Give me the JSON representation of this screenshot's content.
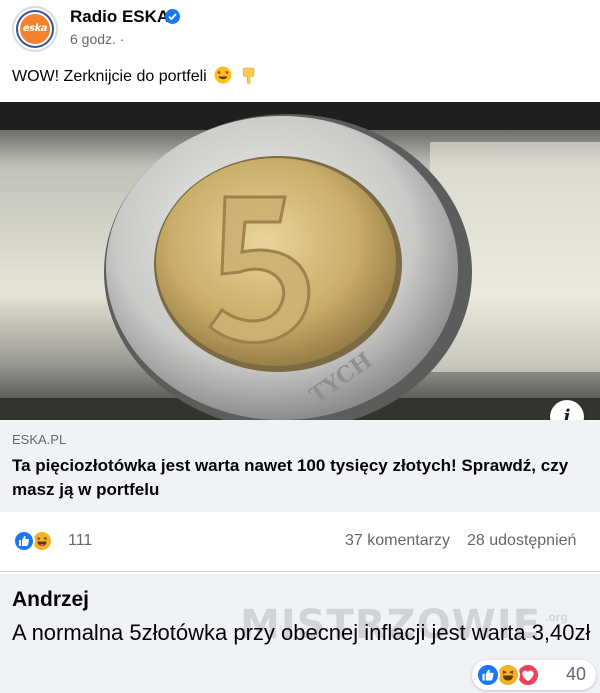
{
  "post": {
    "page_name": "Radio ESKA",
    "avatar_text": "eska",
    "time": "6 godz. ·",
    "text": "WOW! Zerknijcie do portfeli",
    "text_emojis": [
      "heart-eyes-emoji",
      "pointing-down-emoji"
    ]
  },
  "link_preview": {
    "domain": "ESKA.PL",
    "title": "Ta pięciozłotówka jest warta nawet 100 tysięcy złotych! Sprawdź, czy masz ją w portfelu",
    "info_label": "i"
  },
  "reactions": {
    "icons": [
      "like-icon",
      "haha-icon"
    ],
    "count": "111",
    "comments": "37 komentarzy",
    "shares": "28 udostępnień"
  },
  "comment": {
    "author": "Andrzej",
    "text": "A normalna 5złotówka przy obecnej inflacji jest warta 3,40zł",
    "watermark": "MISTRZOWIE",
    "watermark_suffix": ".org",
    "reaction_icons": [
      "like-icon",
      "haha-icon",
      "love-icon"
    ],
    "reaction_count": "40"
  },
  "colors": {
    "facebook_blue": "#1877f2",
    "secondary_text": "#65676b",
    "bubble_bg": "#f0f2f5"
  }
}
